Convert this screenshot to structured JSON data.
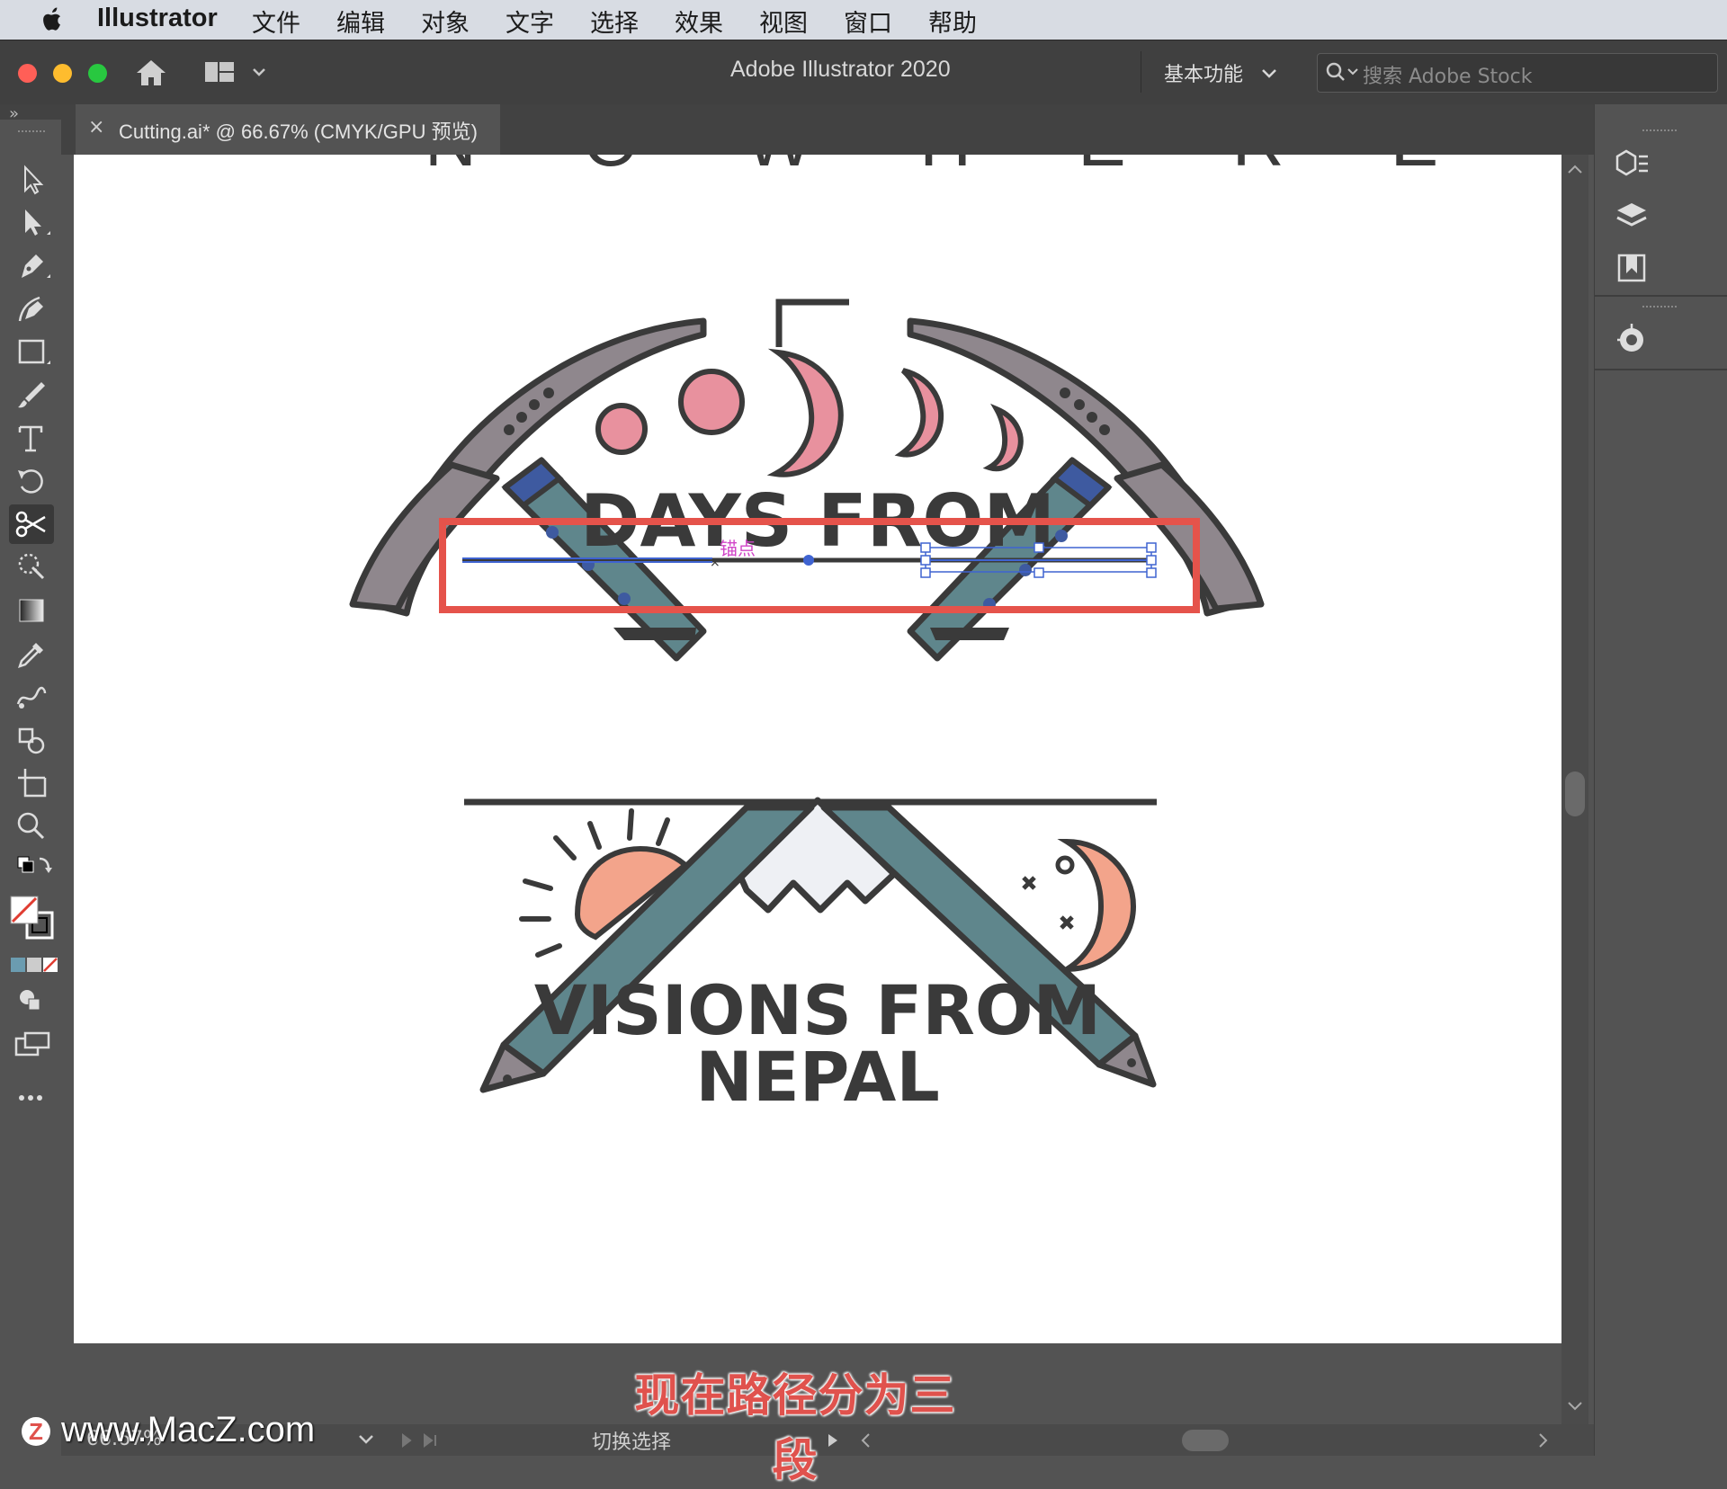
{
  "menubar": {
    "app": "Illustrator",
    "items": [
      "文件",
      "编辑",
      "对象",
      "文字",
      "选择",
      "效果",
      "视图",
      "窗口",
      "帮助"
    ]
  },
  "window": {
    "title": "Adobe Illustrator 2020",
    "workspace": "基本功能",
    "search_placeholder": "搜索 Adobe Stock"
  },
  "document_tab": {
    "close": "×",
    "label": "Cutting.ai* @ 66.67% (CMYK/GPU 预览)"
  },
  "artwork": {
    "top_text": "N O W H E R E",
    "moon_number": "5",
    "line1": "DAYS FROM",
    "anchor_tooltip": "锚点",
    "line2": "VISIONS FROM",
    "line3": "NEPAL"
  },
  "status": {
    "zoom": "66.67%",
    "mode": "切换选择"
  },
  "caption": "现在路径分为三段",
  "watermark": "www.MacZ.com",
  "colors": {
    "highlight_box": "#e5534b",
    "selection": "#3f63d1",
    "pink": "#e8919e",
    "teal": "#5f868c",
    "grey_metal": "#8f878d",
    "outline": "#3a3a3a"
  }
}
